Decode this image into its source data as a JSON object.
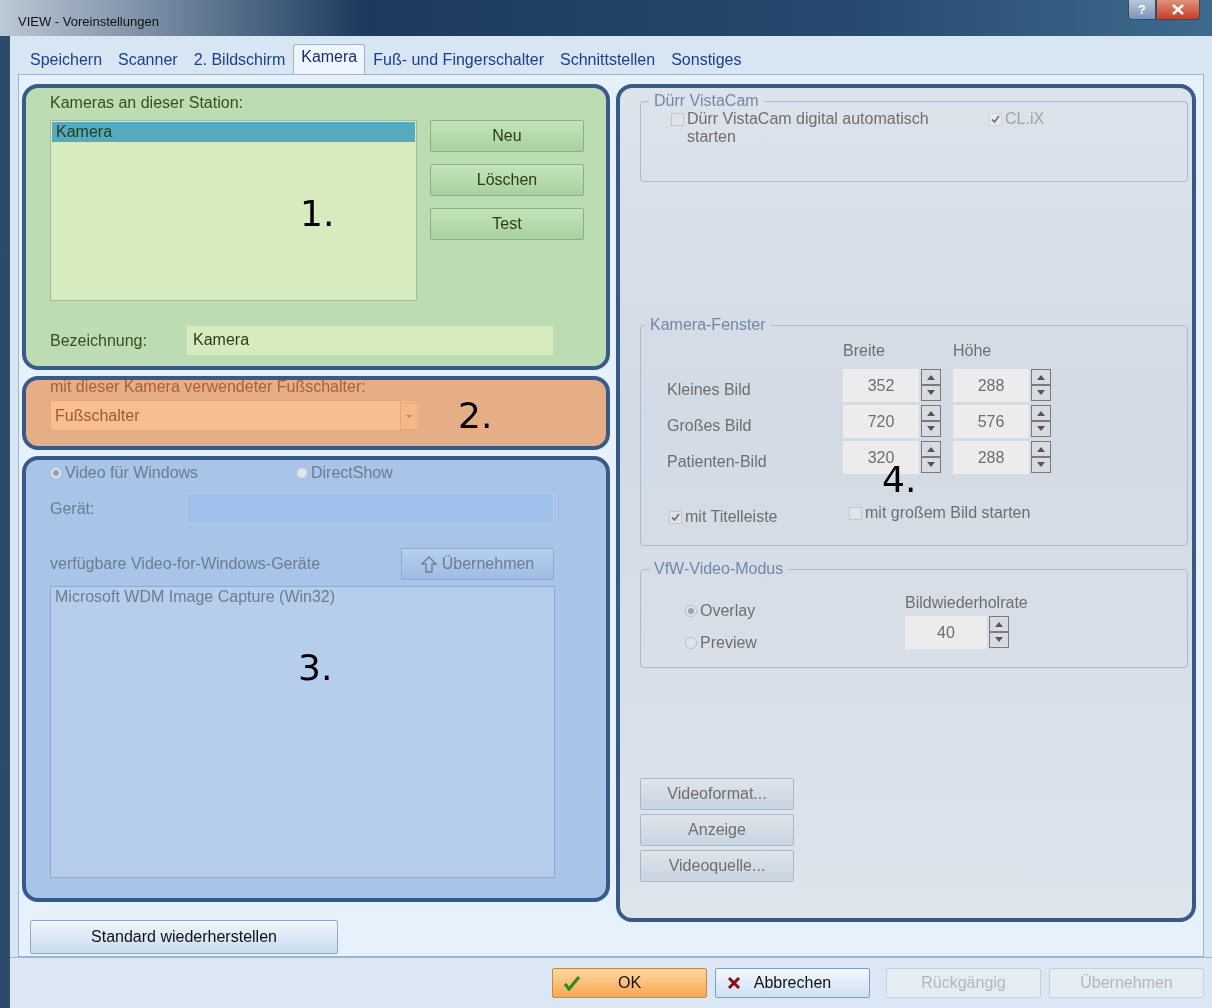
{
  "window": {
    "title": "VIEW - Voreinstellungen",
    "help_label": "?"
  },
  "tabs": [
    {
      "label": "Speichern",
      "selected": false
    },
    {
      "label": "Scanner",
      "selected": false
    },
    {
      "label": "2. Bildschirm",
      "selected": false
    },
    {
      "label": "Kamera",
      "selected": true
    },
    {
      "label": "Fuß- und Fingerschalter",
      "selected": false
    },
    {
      "label": "Schnittstellen",
      "selected": false
    },
    {
      "label": "Sonstiges",
      "selected": false
    }
  ],
  "cameras_section": {
    "label": "Kameras an dieser Station:",
    "list": [
      {
        "text": "Kamera",
        "selected": true
      }
    ],
    "buttons": [
      "Neu",
      "Löschen",
      "Test"
    ],
    "name_label": "Bezeichnung:",
    "name_value": "Kamera",
    "marker": "1."
  },
  "footswitch_section": {
    "label": "mit dieser Kamera verwendeter Fußschalter:",
    "value": "Fußschalter",
    "marker": "2."
  },
  "driver_section": {
    "options": [
      {
        "label": "Video für Windows",
        "selected": true
      },
      {
        "label": "DirectShow",
        "selected": false
      }
    ],
    "device_label": "Gerät:",
    "available_label": "verfügbare Video-for-Windows-Geräte",
    "apply_button": "Übernehmen",
    "devices": [
      {
        "text": "Microsoft WDM Image Capture (Win32)",
        "selected": false
      }
    ],
    "marker": "3."
  },
  "restore_button": "Standard wiederherstellen",
  "right_section": {
    "vistacam": {
      "title": "Dürr VistaCam",
      "checks": [
        {
          "label": "Dürr VistaCam digital automatisch starten",
          "checked": false,
          "disabled": false
        },
        {
          "label": "CL.iX",
          "checked": true,
          "disabled": true
        }
      ]
    },
    "camera_window": {
      "title": "Kamera-Fenster",
      "columns": [
        "Breite",
        "Höhe"
      ],
      "rows": [
        {
          "label": "Kleines Bild",
          "values": [
            "352",
            "288"
          ]
        },
        {
          "label": "Großes Bild",
          "values": [
            "720",
            "576"
          ]
        },
        {
          "label": "Patienten-Bild",
          "values": [
            "320",
            "288"
          ]
        }
      ],
      "checks": [
        {
          "label": "mit Titelleiste",
          "checked": true
        },
        {
          "label": "mit großem Bild starten",
          "checked": false
        }
      ]
    },
    "vfw_mode": {
      "title": "VfW-Video-Modus",
      "options": [
        {
          "label": "Overlay",
          "selected": true
        },
        {
          "label": "Preview",
          "selected": false
        }
      ],
      "rate_label": "Bildwiederholrate",
      "rate_value": "40"
    },
    "buttons": [
      "Videoformat...",
      "Anzeige",
      "Videoquelle..."
    ],
    "marker": "4."
  },
  "footer_buttons": [
    {
      "label": "OK",
      "kind": "ok",
      "disabled": false
    },
    {
      "label": "Abbrechen",
      "kind": "cancel",
      "disabled": false
    },
    {
      "label": "Rückgängig",
      "kind": "plain",
      "disabled": true
    },
    {
      "label": "Übernehmen",
      "kind": "plain",
      "disabled": true
    }
  ]
}
